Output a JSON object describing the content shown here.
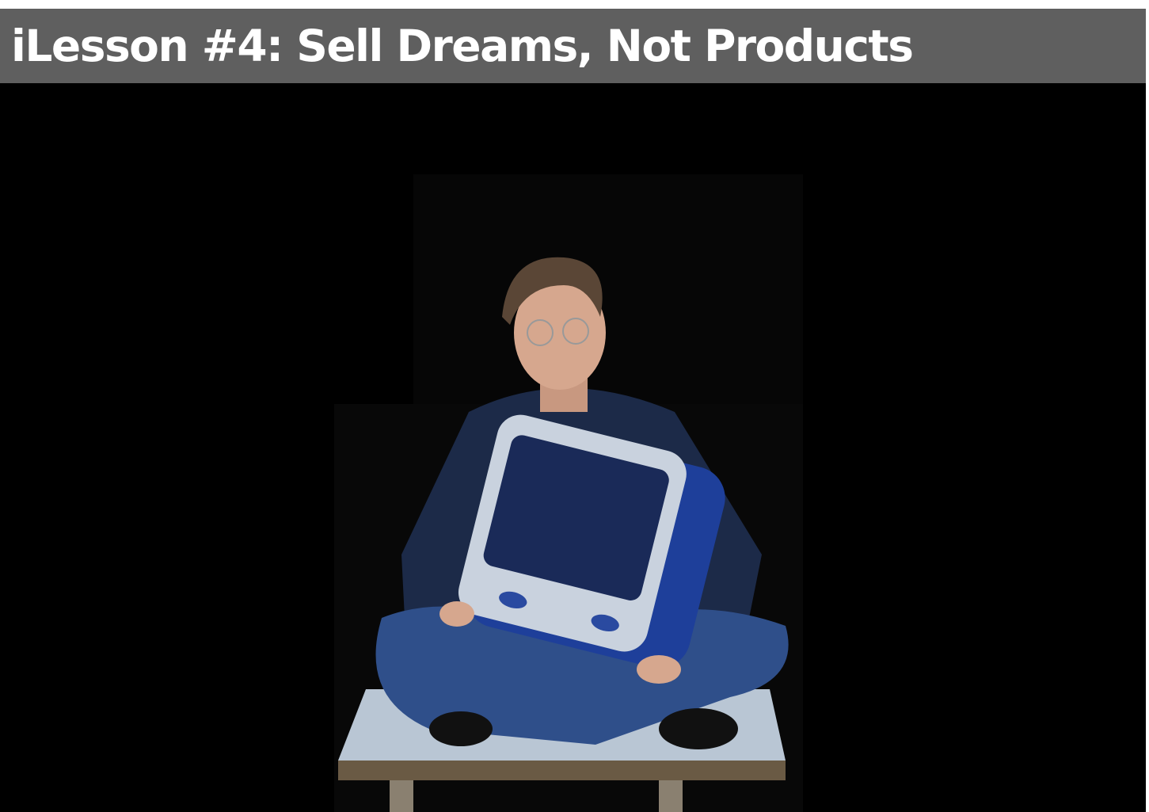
{
  "slide": {
    "title": "iLesson #4: Sell Dreams, Not Products",
    "colors": {
      "title_bar": "#5f5f5f",
      "background": "#000000",
      "title_text": "#ffffff"
    },
    "photo": {
      "subject": "man sitting cross-legged on a table holding a blue iMac"
    }
  }
}
